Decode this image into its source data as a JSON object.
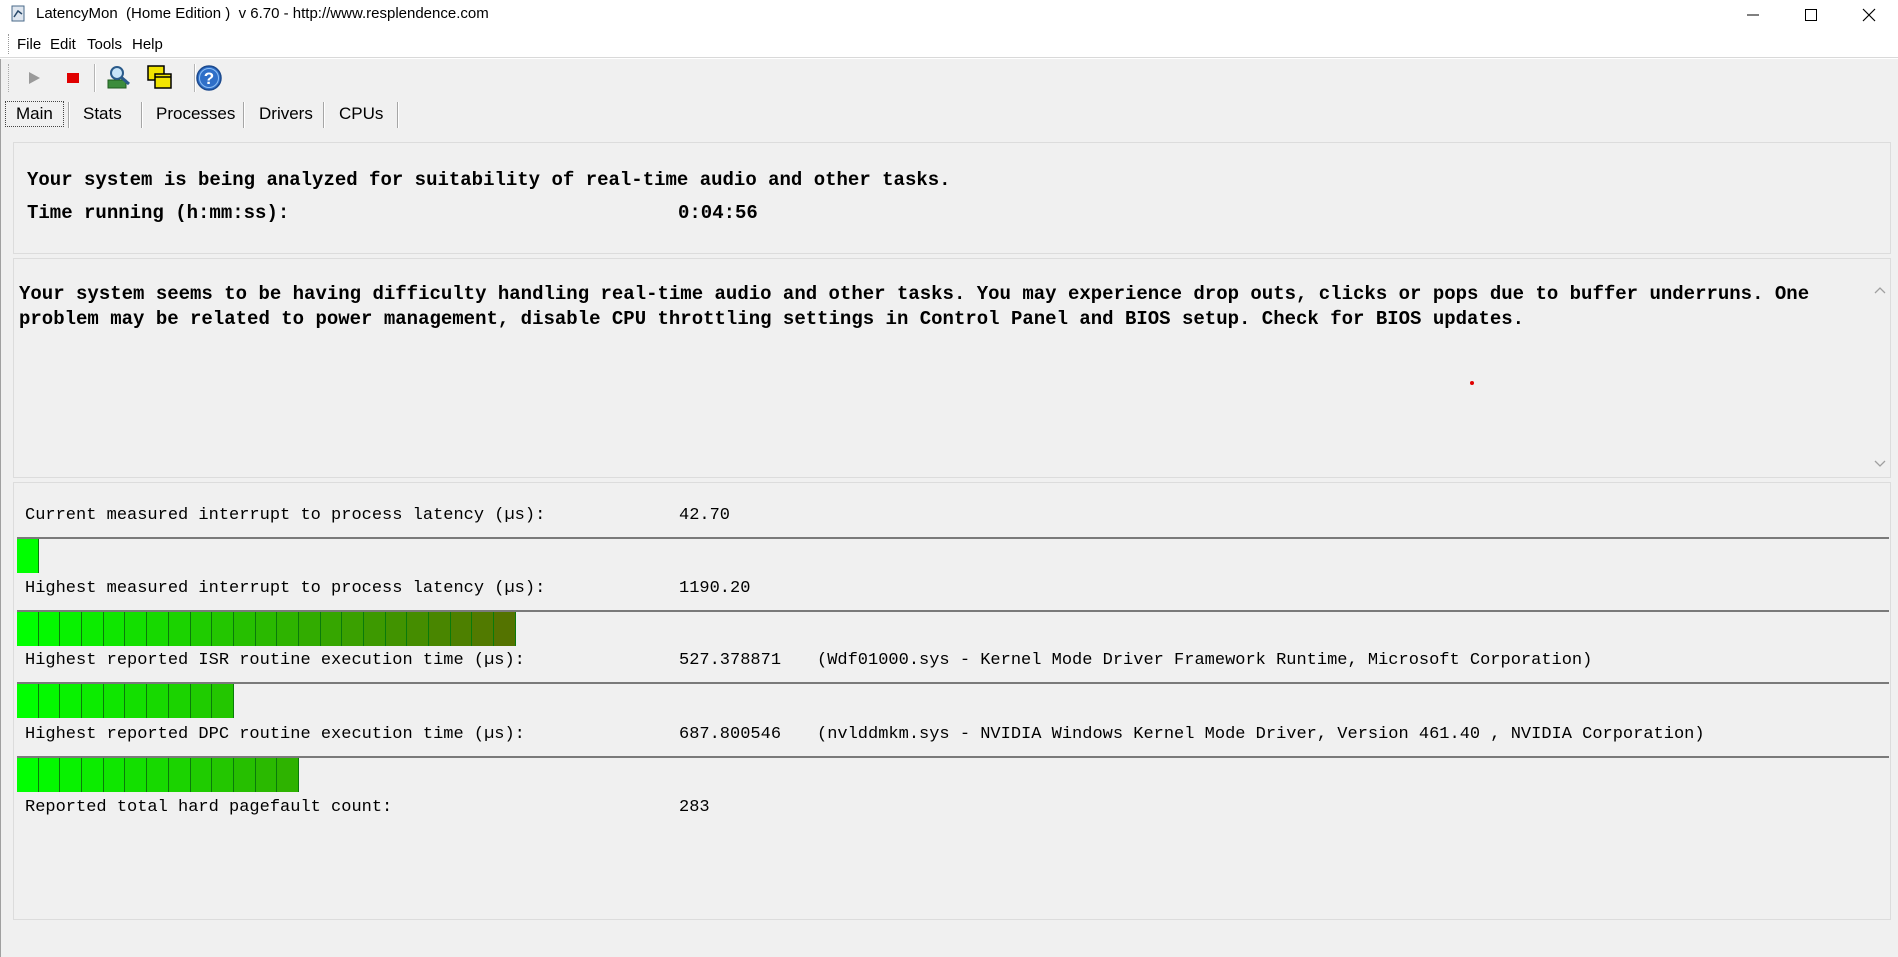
{
  "window": {
    "title": "LatencyMon  (Home Edition )  v 6.70 - http://www.resplendence.com"
  },
  "menu": [
    "File",
    "Edit",
    "Tools",
    "Help"
  ],
  "toolbar": {
    "buttons": [
      "play-icon",
      "stop-icon",
      "search-drivers-icon",
      "windows-icon",
      "help-icon"
    ]
  },
  "tabs": [
    "Main",
    "Stats",
    "Processes",
    "Drivers",
    "CPUs"
  ],
  "status": {
    "line1": "Your system is being analyzed for suitability of real-time audio and other tasks.",
    "time_label": "Time running (h:mm:ss):",
    "time_value": "0:04:56"
  },
  "message": "Your system seems to be having difficulty handling real-time audio and other tasks. You may experience drop outs, clicks or pops due to buffer underruns. One problem may be related to power management, disable CPU throttling settings in Control Panel and BIOS setup. Check for BIOS updates.",
  "stats": [
    {
      "label": "Current measured interrupt to process latency (µs):",
      "value": "42.70",
      "driver": "",
      "bar_fraction": 0.013,
      "bar_segments": 1
    },
    {
      "label": "Highest measured interrupt to process latency (µs):",
      "value": "1190.20",
      "driver": "",
      "bar_fraction": 0.32,
      "bar_segments": 23
    },
    {
      "label": "Highest reported ISR routine execution time (µs):",
      "value": "527.378871",
      "driver": "(Wdf01000.sys - Kernel Mode Driver Framework Runtime, Microsoft Corporation)",
      "bar_fraction": 0.145,
      "bar_segments": 10
    },
    {
      "label": "Highest reported DPC routine execution time (µs):",
      "value": "687.800546",
      "driver": "(nvlddmkm.sys - NVIDIA Windows Kernel Mode Driver, Version 461.40 , NVIDIA Corporation)",
      "bar_fraction": 0.189,
      "bar_segments": 13
    }
  ],
  "pagefault": {
    "label": "Reported total hard pagefault count:",
    "value": "283"
  },
  "colors": {
    "bar_start": "#00ff00",
    "bar_end": "#5a6a00"
  }
}
